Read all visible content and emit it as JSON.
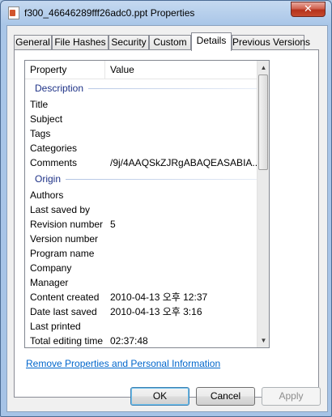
{
  "window": {
    "title": "f300_46646289fff26adc0.ppt Properties",
    "close_label": "✕"
  },
  "tabs": [
    {
      "label": "General",
      "active": false
    },
    {
      "label": "File Hashes",
      "active": false
    },
    {
      "label": "Security",
      "active": false
    },
    {
      "label": "Custom",
      "active": false
    },
    {
      "label": "Details",
      "active": true
    },
    {
      "label": "Previous Versions",
      "active": false
    }
  ],
  "details": {
    "columns": {
      "property": "Property",
      "value": "Value"
    },
    "groups": [
      {
        "name": "Description",
        "rows": [
          {
            "property": "Title",
            "value": ""
          },
          {
            "property": "Subject",
            "value": ""
          },
          {
            "property": "Tags",
            "value": ""
          },
          {
            "property": "Categories",
            "value": ""
          },
          {
            "property": "Comments",
            "value": "/9j/4AAQSkZJRgABAQEASABIA..."
          }
        ]
      },
      {
        "name": "Origin",
        "rows": [
          {
            "property": "Authors",
            "value": ""
          },
          {
            "property": "Last saved by",
            "value": ""
          },
          {
            "property": "Revision number",
            "value": "5"
          },
          {
            "property": "Version number",
            "value": ""
          },
          {
            "property": "Program name",
            "value": ""
          },
          {
            "property": "Company",
            "value": ""
          },
          {
            "property": "Manager",
            "value": ""
          },
          {
            "property": "Content created",
            "value": "2010-04-13 오후 12:37"
          },
          {
            "property": "Date last saved",
            "value": "2010-04-13 오후 3:16"
          },
          {
            "property": "Last printed",
            "value": ""
          },
          {
            "property": "Total editing time",
            "value": "02:37:48"
          }
        ]
      }
    ]
  },
  "link": {
    "label": "Remove Properties and Personal Information"
  },
  "buttons": {
    "ok": "OK",
    "cancel": "Cancel",
    "apply": "Apply"
  },
  "icons": {
    "close": "close-icon",
    "file": "powerpoint-file-icon",
    "scroll_up": "chevron-up-icon",
    "scroll_down": "chevron-down-icon"
  }
}
